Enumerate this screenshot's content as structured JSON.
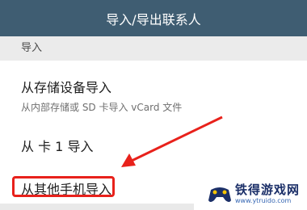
{
  "header": {
    "title": "导入/导出联系人"
  },
  "section": {
    "label": "导入"
  },
  "items": [
    {
      "title": "从存储设备导入",
      "subtitle": "从内部存储或 SD 卡导入 vCard 文件"
    },
    {
      "title": "从 卡 1 导入"
    },
    {
      "title": "从其他手机导入"
    }
  ],
  "annotation": {
    "color": "#e8211b"
  },
  "watermark": {
    "title": "铁得游戏网",
    "url": "www.ytruido.com",
    "icon": "gamepad-logo-icon"
  }
}
